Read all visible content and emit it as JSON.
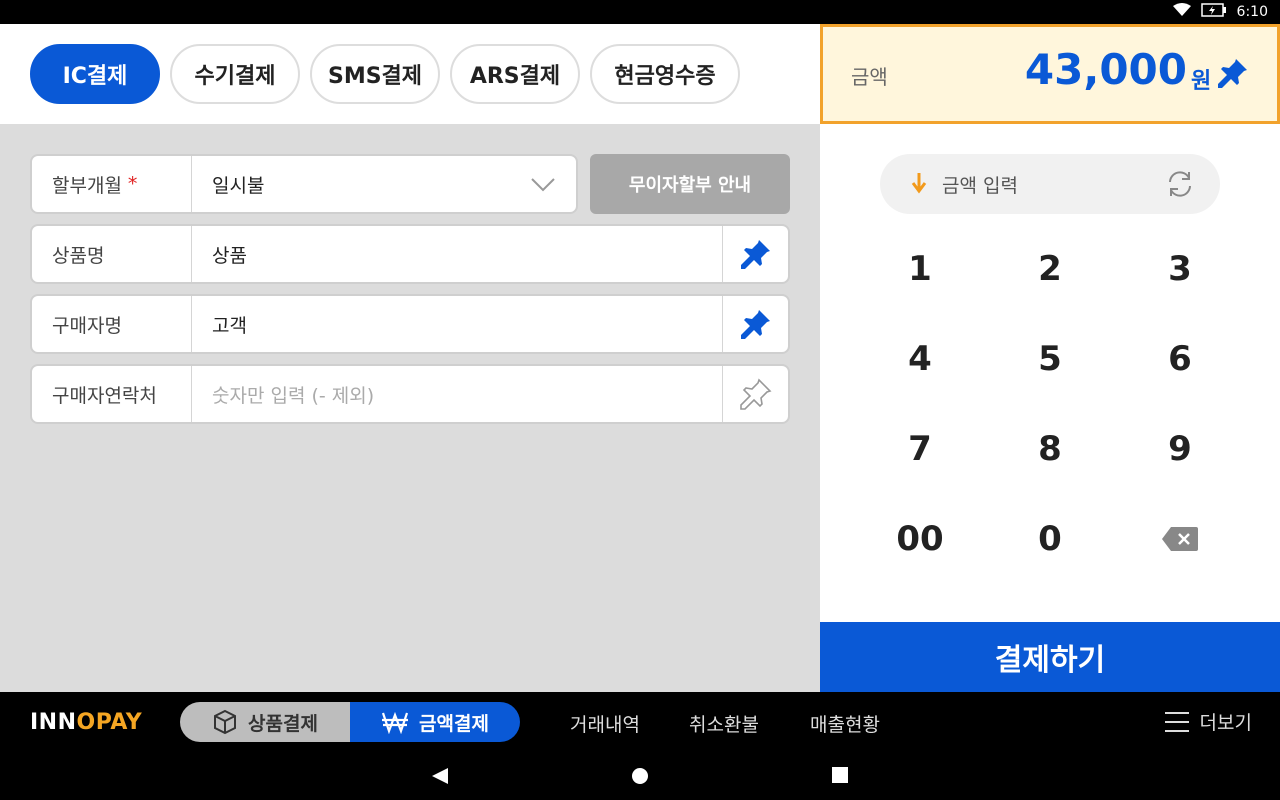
{
  "status": {
    "time": "6:10"
  },
  "tabs": [
    "IC결제",
    "수기결제",
    "SMS결제",
    "ARS결제",
    "현금영수증"
  ],
  "form": {
    "installment": {
      "label": "할부개월",
      "required_mark": "*",
      "value": "일시불"
    },
    "interest_free_button": "무이자할부 안내",
    "product": {
      "label": "상품명",
      "value": "상품"
    },
    "buyer": {
      "label": "구매자명",
      "value": "고객"
    },
    "contact": {
      "label": "구매자연락처",
      "placeholder": "숫자만 입력 (- 제외)"
    }
  },
  "amount": {
    "label": "금액",
    "value": "43,000",
    "unit": "원"
  },
  "amount_input": {
    "label": "금액 입력"
  },
  "keypad": [
    "1",
    "2",
    "3",
    "4",
    "5",
    "6",
    "7",
    "8",
    "9",
    "00",
    "0"
  ],
  "pay_button": "결제하기",
  "bottom_nav": {
    "logo_left": "INN",
    "logo_o": "O",
    "logo_right": "PAY",
    "product_payment": "상품결제",
    "amount_payment": "금액결제",
    "history": "거래내역",
    "refund": "취소환불",
    "sales": "매출현황",
    "more": "더보기"
  },
  "colors": {
    "primary": "#0a59d6",
    "accent": "#f2a22b",
    "amount_bg": "#fff6dc"
  }
}
